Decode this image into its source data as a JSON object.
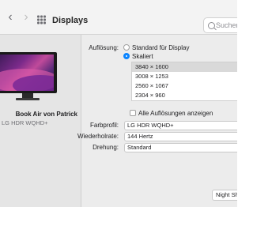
{
  "toolbar": {
    "title": "Displays",
    "back_glyph": "‹",
    "forward_glyph": "›",
    "search_placeholder": "Suchen"
  },
  "sidebar": {
    "display_name": "Book Air von Patrick",
    "display_model": "LG HDR WQHD+"
  },
  "resolution": {
    "label": "Auflösung:",
    "option_default": "Standard für Display",
    "option_scaled": "Skaliert",
    "selected_option": "Skaliert",
    "list": [
      "3840 × 1600",
      "3008 × 1253",
      "2560 × 1067",
      "2304 × 960"
    ],
    "selected_index": 0,
    "show_all_label": "Alle Auflösungen anzeigen"
  },
  "color_profile": {
    "label": "Farbprofil:",
    "value": "LG HDR WQHD+"
  },
  "refresh_rate": {
    "label": "Wiederholrate:",
    "value": "144 Hertz"
  },
  "rotation": {
    "label": "Drehung:",
    "value": "Standard"
  },
  "night_shift_button": "Night Shi",
  "colors": {
    "accent": "#0a84ff",
    "selected_row": "#d9d9d9",
    "window_bg": "#ececec"
  }
}
